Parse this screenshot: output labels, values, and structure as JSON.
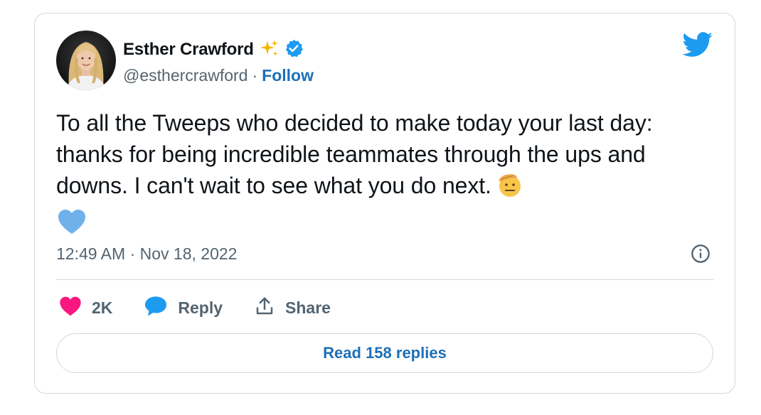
{
  "author": {
    "name": "Esther Crawford",
    "handle": "@esthercrawford",
    "separator": "·",
    "follow_label": "Follow",
    "badge_icon": "sparkles-icon",
    "verified_icon": "verified-badge-icon"
  },
  "tweet": {
    "text": "To all the Tweeps who decided to make today your last day: thanks for being incredible teammates through the ups and downs. I can't wait to see what you do next.",
    "emojis": [
      "saluting-face-emoji",
      "blue-heart-emoji"
    ],
    "timestamp": "12:49 AM · Nov 18, 2022"
  },
  "actions": {
    "likes_count": "2K",
    "reply_label": "Reply",
    "share_label": "Share"
  },
  "footer": {
    "read_replies_label": "Read 158 replies"
  },
  "colors": {
    "twitter_blue": "#1d9bf0",
    "link_blue": "#1d6fb8",
    "like_pink": "#f91880",
    "secondary_text": "#536471",
    "border": "#cfd9de"
  }
}
